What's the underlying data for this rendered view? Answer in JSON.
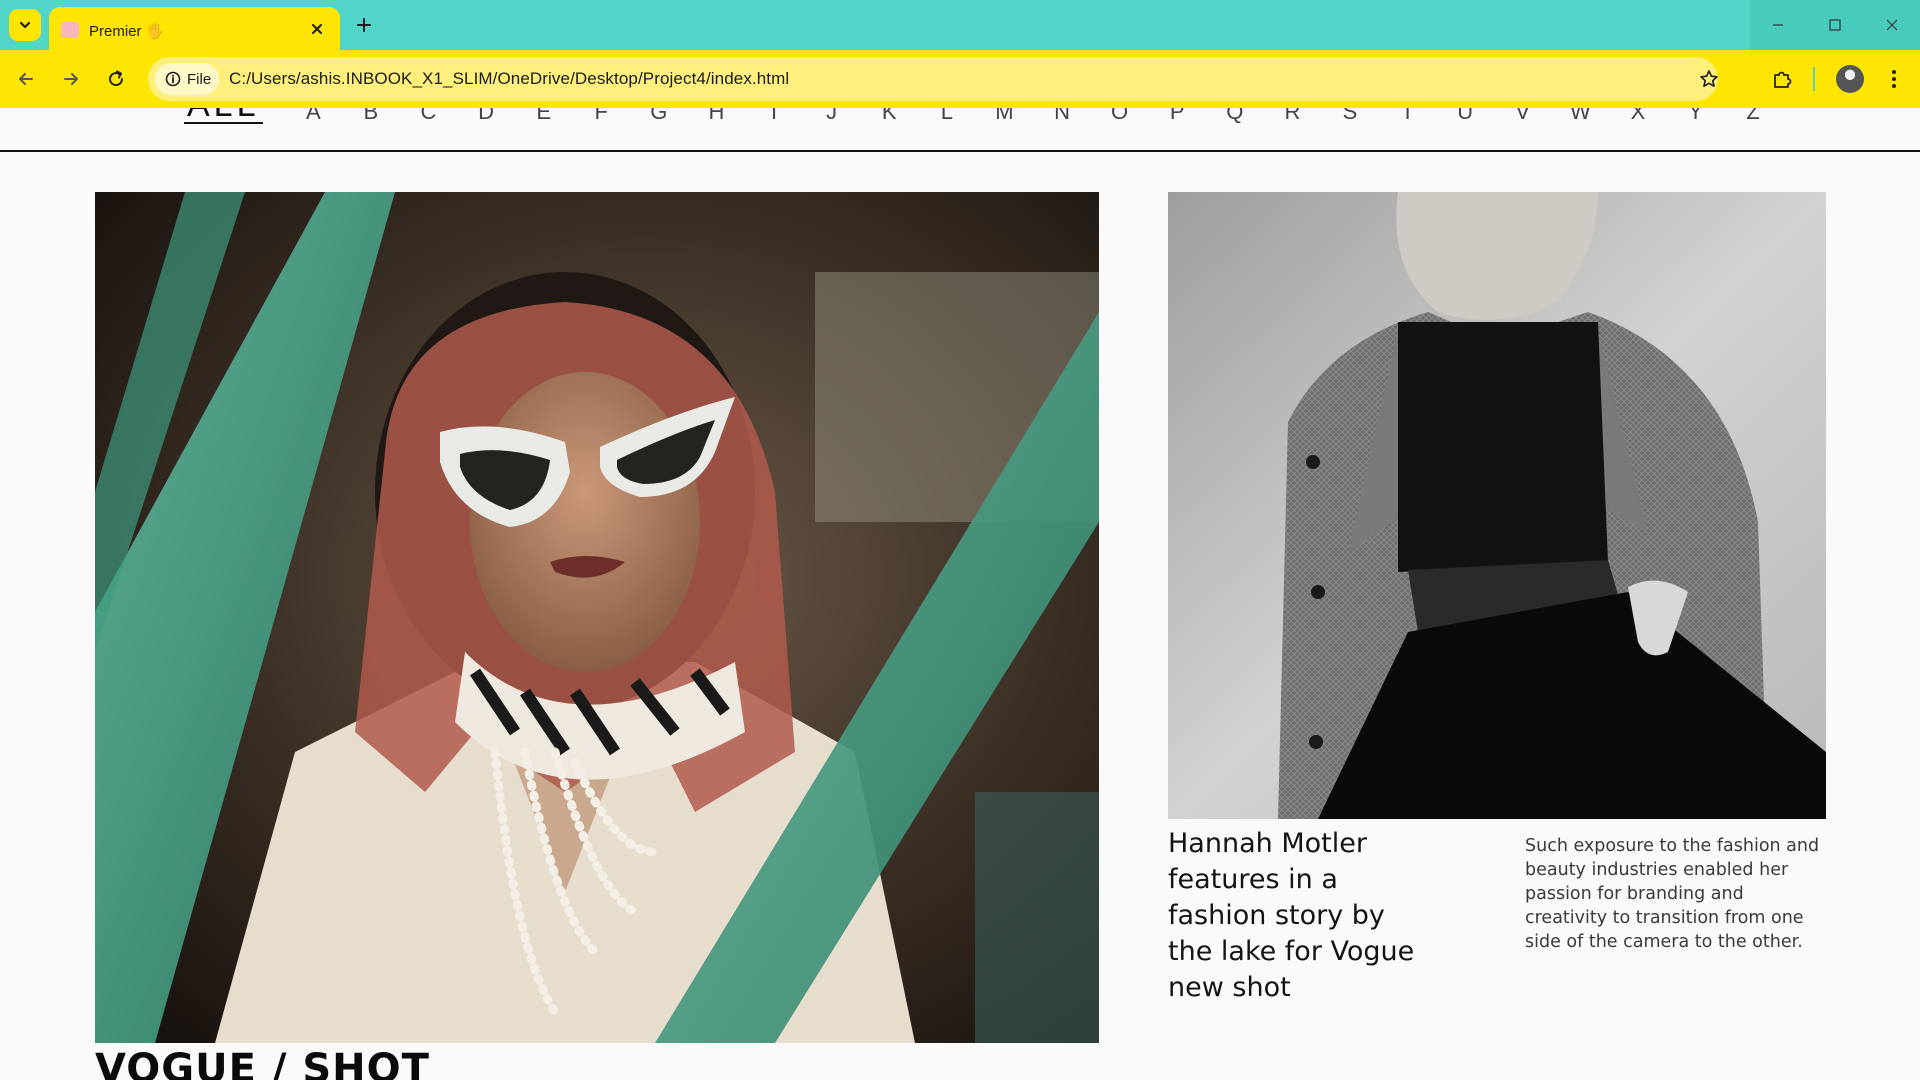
{
  "browser": {
    "tab_title": "Premier 🖐",
    "site_info_label": "File",
    "url": "C:/Users/ashis.INBOOK_X1_SLIM/OneDrive/Desktop/Project4/index.html",
    "colors": {
      "tabbar": "#52d5c9",
      "toolbar": "#ffe602",
      "omnibox": "#fff07d"
    }
  },
  "page": {
    "alpha_nav": {
      "all_label": "ALL",
      "letters": [
        "A",
        "B",
        "C",
        "D",
        "E",
        "F",
        "G",
        "H",
        "I",
        "J",
        "K",
        "L",
        "M",
        "N",
        "O",
        "P",
        "Q",
        "R",
        "S",
        "T",
        "U",
        "V",
        "W",
        "X",
        "Y",
        "Z"
      ]
    },
    "hero": {
      "image_description": "Woman in white cat-eye sunglasses and patterned headscarf seen through green car window frame",
      "title": "VOGUE / SHOT"
    },
    "feature": {
      "image_description": "Black and white photo of woman in tweed jacket and black crop top",
      "headline": "Hannah Motler features in a fashion story by the lake for Vogue new shot",
      "body": "Such exposure to the fashion and beauty industries enabled her passion for branding and creativity to transition from one side of the camera to the other."
    }
  }
}
